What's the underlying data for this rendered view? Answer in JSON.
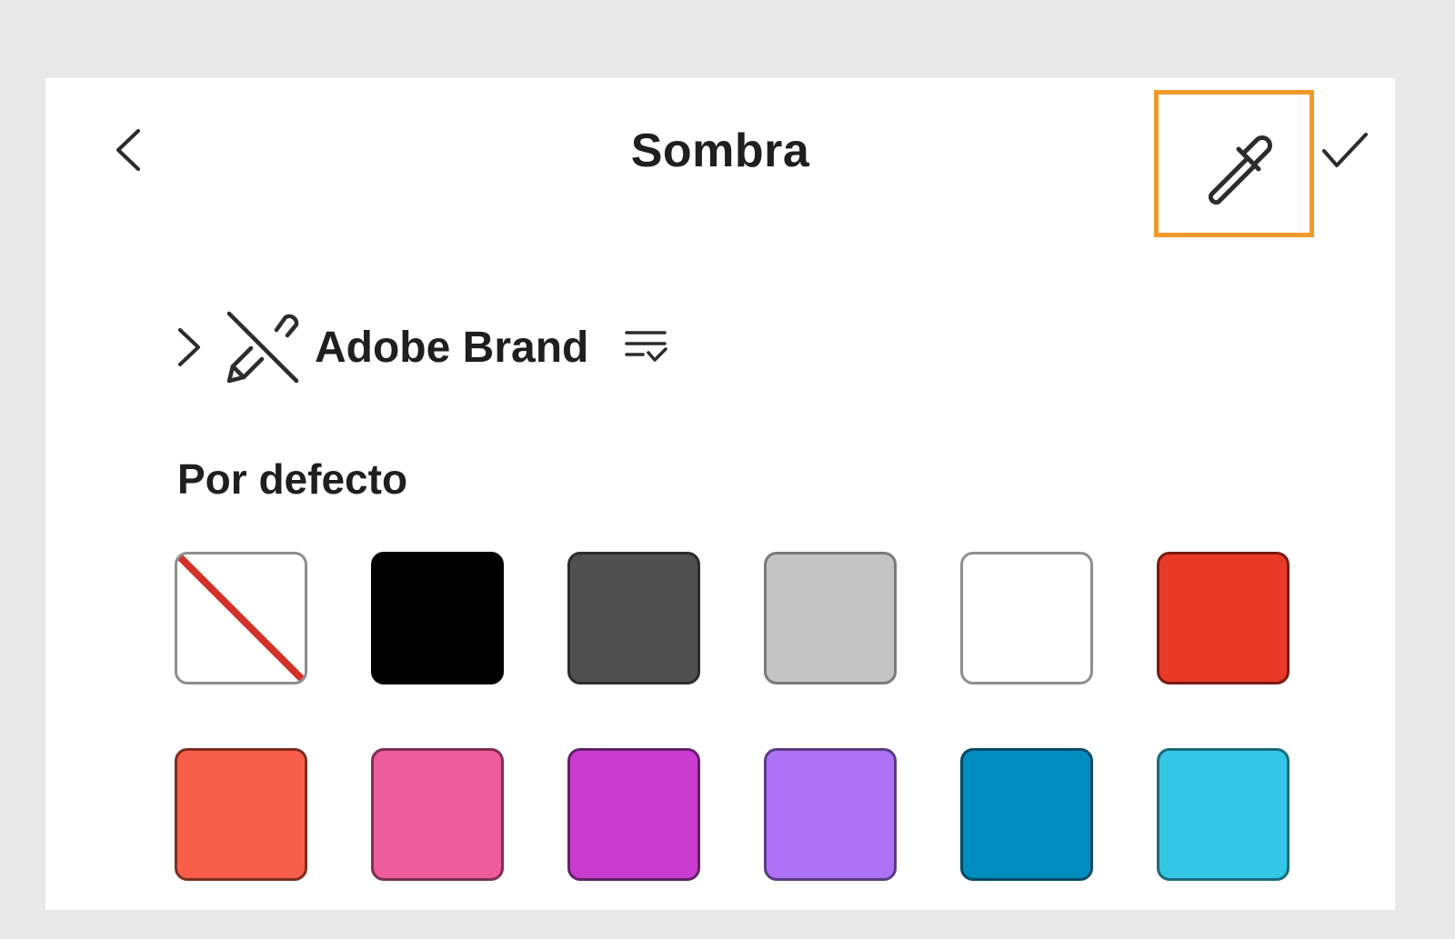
{
  "header": {
    "title": "Sombra"
  },
  "library": {
    "name": "Adobe Brand"
  },
  "section": {
    "title": "Por defecto"
  },
  "colors": {
    "highlight": "#ef9a2a",
    "icon": "#2c2c2c"
  },
  "swatches": [
    {
      "name": "none",
      "fill": "#ffffff",
      "border": "#8e8e8e"
    },
    {
      "name": "black",
      "fill": "#000000",
      "border": "#000000"
    },
    {
      "name": "dark-gray",
      "fill": "#505050",
      "border": "#2c2c2c"
    },
    {
      "name": "light-gray",
      "fill": "#c4c4c4",
      "border": "#7a7a7a"
    },
    {
      "name": "white",
      "fill": "#ffffff",
      "border": "#8e8e8e"
    },
    {
      "name": "red",
      "fill": "#e93a28",
      "border": "#7a1a12"
    },
    {
      "name": "orange-red",
      "fill": "#f85f4a",
      "border": "#7e2c20"
    },
    {
      "name": "pink",
      "fill": "#ef5c9b",
      "border": "#7e2f52"
    },
    {
      "name": "magenta",
      "fill": "#c93ccf",
      "border": "#63206a"
    },
    {
      "name": "lavender",
      "fill": "#ad73f4",
      "border": "#583c82"
    },
    {
      "name": "teal-blue",
      "fill": "#008cbf",
      "border": "#004a66"
    },
    {
      "name": "cyan",
      "fill": "#35c6e6",
      "border": "#1a6a7a"
    }
  ]
}
